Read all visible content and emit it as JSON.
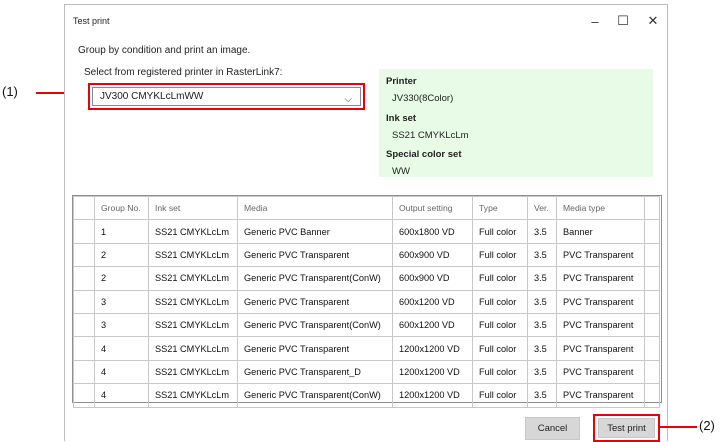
{
  "window": {
    "title": "Test print"
  },
  "subtitle": "Group by condition and print an image.",
  "printer_select": {
    "label": "Select from registered printer in RasterLink7:",
    "value": "JV300 CMYKLcLmWW"
  },
  "info": {
    "printer_label": "Printer",
    "printer_value": "JV330(8Color)",
    "inkset_label": "Ink set",
    "inkset_value": "SS21 CMYKLcLm",
    "special_label": "Special color set",
    "special_value": "WW"
  },
  "table": {
    "headers": [
      "Group No.",
      "Ink set",
      "Media",
      "Output setting",
      "Type",
      "Ver.",
      "Media type"
    ],
    "rows": [
      [
        "1",
        "SS21 CMYKLcLm",
        "Generic PVC Banner",
        "600x1800 VD",
        "Full color",
        "3.5",
        "Banner"
      ],
      [
        "2",
        "SS21 CMYKLcLm",
        "Generic PVC Transparent",
        "600x900 VD",
        "Full color",
        "3.5",
        "PVC Transparent"
      ],
      [
        "2",
        "SS21 CMYKLcLm",
        "Generic PVC Transparent(ConW)",
        "600x900 VD",
        "Full color",
        "3.5",
        "PVC Transparent"
      ],
      [
        "3",
        "SS21 CMYKLcLm",
        "Generic PVC Transparent",
        "600x1200 VD",
        "Full color",
        "3.5",
        "PVC Transparent"
      ],
      [
        "3",
        "SS21 CMYKLcLm",
        "Generic PVC Transparent(ConW)",
        "600x1200 VD",
        "Full color",
        "3.5",
        "PVC Transparent"
      ],
      [
        "4",
        "SS21 CMYKLcLm",
        "Generic PVC Transparent",
        "1200x1200 VD",
        "Full color",
        "3.5",
        "PVC Transparent"
      ],
      [
        "4",
        "SS21 CMYKLcLm",
        "Generic PVC Transparent_D",
        "1200x1200 VD",
        "Full color",
        "3.5",
        "PVC Transparent"
      ],
      [
        "4",
        "SS21 CMYKLcLm",
        "Generic PVC Transparent(ConW)",
        "1200x1200 VD",
        "Full color",
        "3.5",
        "PVC Transparent"
      ]
    ]
  },
  "buttons": {
    "cancel": "Cancel",
    "test_print": "Test print"
  },
  "callouts": {
    "one": "(1)",
    "two": "(2)"
  },
  "icons": {
    "minimize": "minimize-icon",
    "maximize": "maximize-icon",
    "close": "close-icon",
    "dropdown": "chevron-down-icon"
  },
  "colors": {
    "highlight": "#e8000b",
    "info_bg": "#e8fbe6",
    "button_bg": "#d7d7d7"
  }
}
